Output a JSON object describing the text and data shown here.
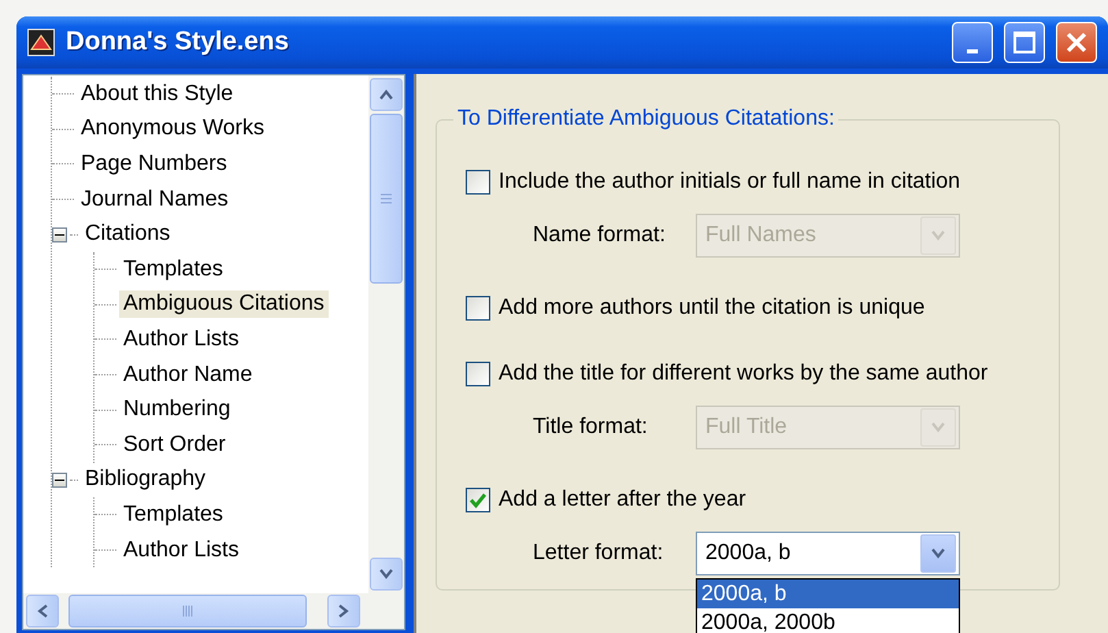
{
  "window": {
    "title": "Donna's Style.ens"
  },
  "tree": [
    {
      "label": "About this Style",
      "selected": false
    },
    {
      "label": "Anonymous Works",
      "selected": false
    },
    {
      "label": "Page Numbers",
      "selected": false
    },
    {
      "label": "Journal Names",
      "selected": false
    },
    {
      "label": "Citations",
      "selected": false,
      "expanded": true,
      "children": [
        {
          "label": "Templates",
          "selected": false
        },
        {
          "label": "Ambiguous Citations",
          "selected": true
        },
        {
          "label": "Author Lists",
          "selected": false
        },
        {
          "label": "Author Name",
          "selected": false
        },
        {
          "label": "Numbering",
          "selected": false
        },
        {
          "label": "Sort Order",
          "selected": false
        }
      ]
    },
    {
      "label": "Bibliography",
      "selected": false,
      "expanded": true,
      "children": [
        {
          "label": "Templates",
          "selected": false
        },
        {
          "label": "Author Lists",
          "selected": false
        }
      ]
    }
  ],
  "group": {
    "title": "To Differentiate Ambiguous Citatations:",
    "options": [
      {
        "label": "Include the author initials or full name in citation",
        "checked": false,
        "format": {
          "label": "Name format:",
          "value": "Full Names",
          "disabled": true
        }
      },
      {
        "label": "Add more authors until the citation is unique",
        "checked": false
      },
      {
        "label": "Add the title for different works by the same author",
        "checked": false,
        "format": {
          "label": "Title format:",
          "value": "Full Title",
          "disabled": true
        }
      },
      {
        "label": "Add a letter after the year",
        "checked": true,
        "format": {
          "label": "Letter format:",
          "value": "2000a, b",
          "disabled": false,
          "options": [
            {
              "label": "2000a, b",
              "selected": true
            },
            {
              "label": "2000a, 2000b",
              "selected": false
            }
          ]
        }
      }
    ]
  }
}
